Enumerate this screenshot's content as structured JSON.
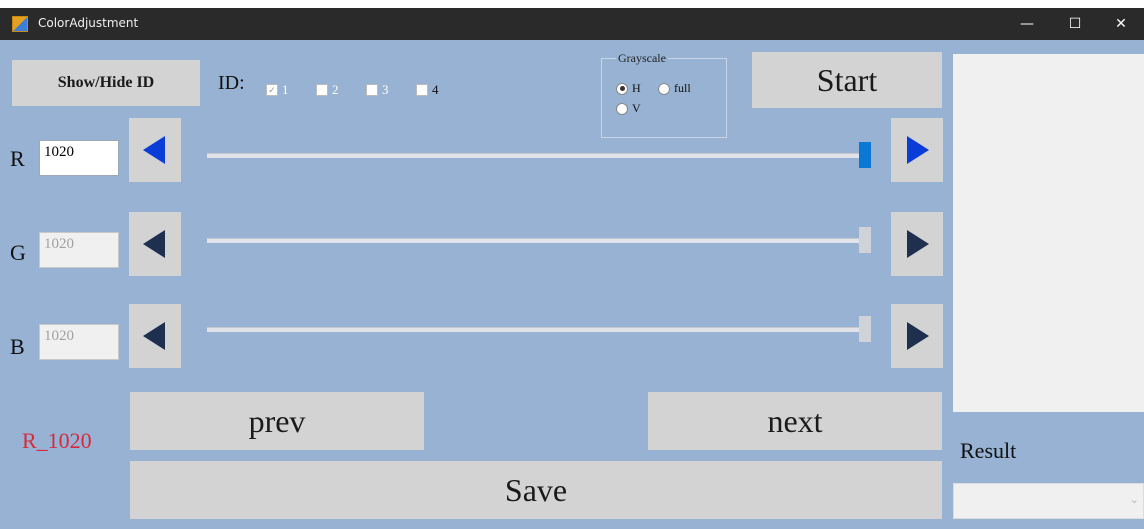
{
  "window": {
    "title": "ColorAdjustment",
    "controls": {
      "minimize": "—",
      "maximize": "☐",
      "close": "✕"
    }
  },
  "toolbar": {
    "show_hide_label": "Show/Hide ID",
    "id_label": "ID:",
    "id_checkboxes": [
      {
        "label": "1",
        "checked": true,
        "enabled": false
      },
      {
        "label": "2",
        "checked": false,
        "enabled": false
      },
      {
        "label": "3",
        "checked": false,
        "enabled": false
      },
      {
        "label": "4",
        "checked": false,
        "enabled": true
      }
    ],
    "start_label": "Start"
  },
  "grayscale": {
    "title": "Grayscale",
    "options": [
      {
        "label": "H",
        "selected": true
      },
      {
        "label": "full",
        "selected": false
      },
      {
        "label": "V",
        "selected": false
      }
    ]
  },
  "channels": [
    {
      "letter": "R",
      "value": "1020",
      "enabled": true,
      "slider_fraction": 1.0,
      "accent": "#0a3dd8"
    },
    {
      "letter": "G",
      "value": "1020",
      "enabled": false,
      "slider_fraction": 1.0,
      "accent": "#1e2f4f"
    },
    {
      "letter": "B",
      "value": "1020",
      "enabled": false,
      "slider_fraction": 1.0,
      "accent": "#1e2f4f"
    }
  ],
  "status": {
    "text": "R_1020",
    "color": "#d8283c"
  },
  "buttons": {
    "prev": "prev",
    "next": "next",
    "save": "Save"
  },
  "result": {
    "label": "Result",
    "value": ""
  },
  "colors": {
    "background": "#97b2d3",
    "button": "#d3d3d3",
    "titlebar": "#2a2a2a",
    "slider_active": "#0a78d7",
    "slider_disabled": "#cfd2d6"
  }
}
